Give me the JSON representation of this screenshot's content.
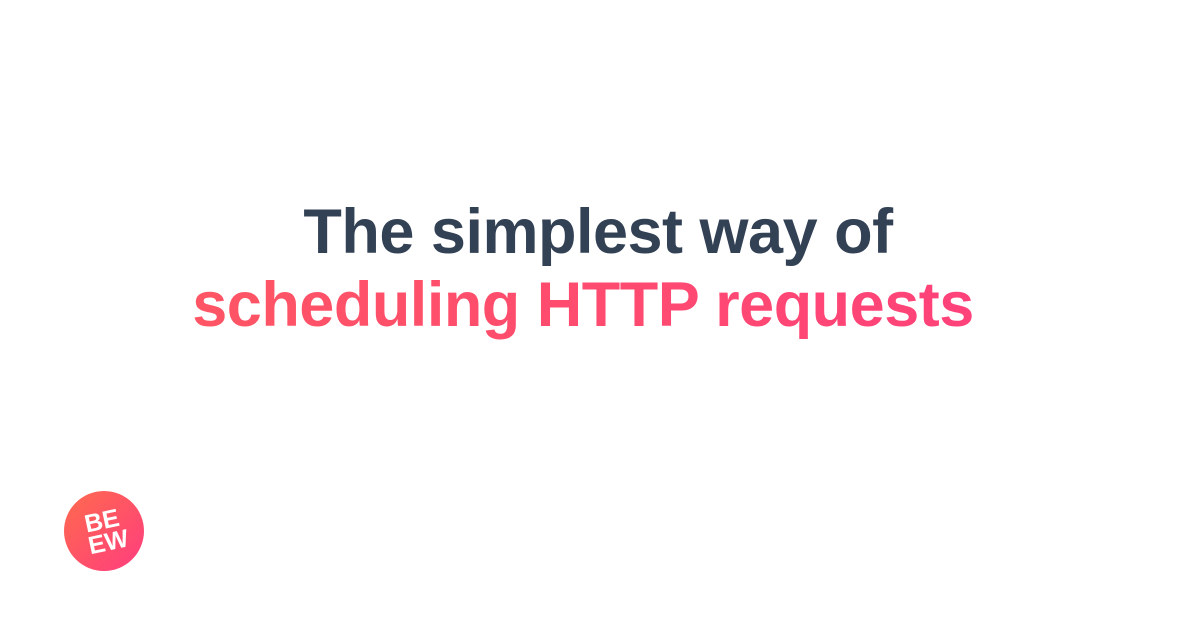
{
  "headline": {
    "line1": "The simplest way of",
    "line2": "scheduling HTTP requests"
  },
  "logo": {
    "text_top": "BE",
    "text_bottom": "EW",
    "colors": {
      "gradient_start": "#ff6a4d",
      "gradient_end": "#ff3d7f",
      "text": "#ffffff"
    }
  },
  "colors": {
    "background": "#ffffff",
    "heading_dark": "#334155",
    "accent": "#ff4d6d"
  }
}
